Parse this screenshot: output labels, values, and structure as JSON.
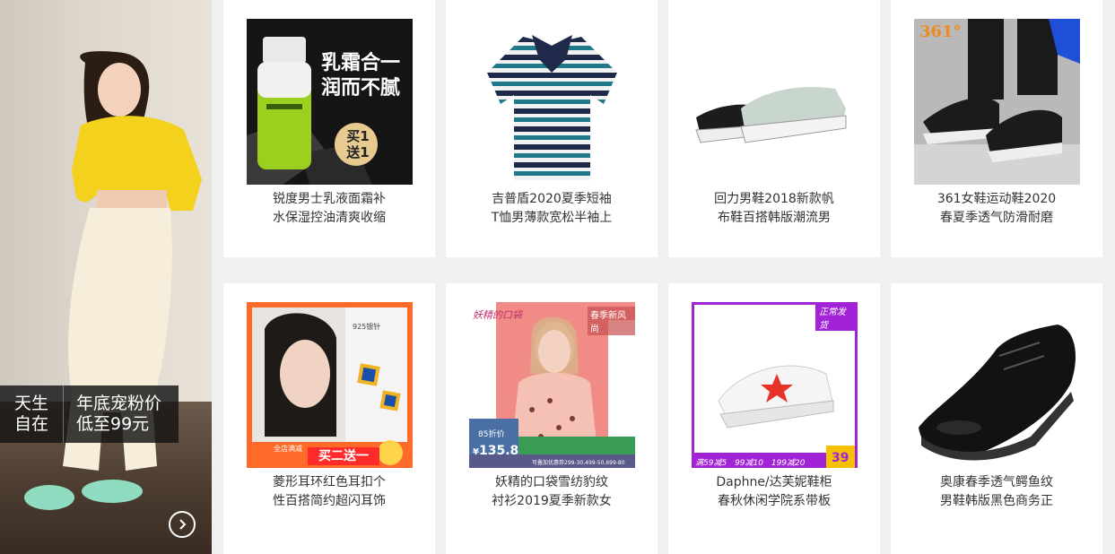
{
  "banner": {
    "badge_left_line1": "天生",
    "badge_left_line2": "自在",
    "badge_right_line1": "年底宠粉价",
    "badge_right_line2": "低至99元",
    "next_icon": "chevron-right-circle-icon"
  },
  "products": [
    {
      "title_line1": "锐度男士乳液面霜补",
      "title_line2": "水保湿控油清爽收缩",
      "image_text_1": "乳霜合一",
      "image_text_2": "润而不腻",
      "image_badge_1": "买1",
      "image_badge_2": "送1"
    },
    {
      "title_line1": "吉普盾2020夏季短袖",
      "title_line2": "T恤男薄款宽松半袖上"
    },
    {
      "title_line1": "回力男鞋2018新款帆",
      "title_line2": "布鞋百搭韩版潮流男"
    },
    {
      "title_line1": "361女鞋运动鞋2020",
      "title_line2": "春夏季透气防滑耐磨",
      "image_logo": "361°"
    },
    {
      "title_line1": "菱形耳环红色耳扣个",
      "title_line2": "性百搭简约超闪耳饰",
      "image_promo": "买二送一",
      "image_tag": "925银针",
      "image_store": "全店满减"
    },
    {
      "title_line1": "妖精的口袋雪纺豹纹",
      "title_line2": "衬衫2019夏季新款女",
      "image_brand": "妖精的口袋",
      "image_tag": "春季新风尚",
      "image_discount": "85折价",
      "image_price": "135.8",
      "image_currency": "¥",
      "image_coupon": "可叠加优惠券299-30,499-50,699-80"
    },
    {
      "title_line1": "Daphne/达芙妮鞋柜",
      "title_line2": "春秋休闲学院系带板",
      "image_tag": "正常发货",
      "image_promo_1": "满59减5",
      "image_promo_2": "99减10",
      "image_promo_3": "199减20",
      "image_price": "39"
    },
    {
      "title_line1": "奥康春季透气鳄鱼纹",
      "title_line2": "男鞋韩版黑色商务正"
    }
  ],
  "colors": {
    "page_bg": "#f0f0f0",
    "card_bg": "#ffffff",
    "accent_orange": "#ff6a2a",
    "accent_purple": "#9b22d6"
  }
}
